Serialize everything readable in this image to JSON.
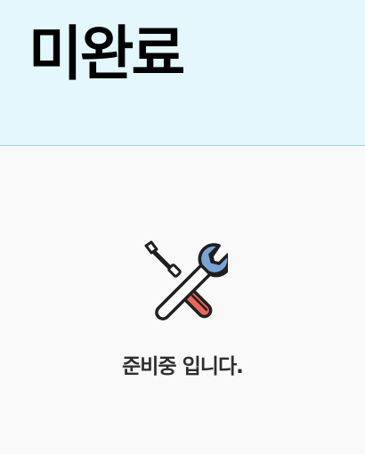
{
  "header": {
    "title": "미완료"
  },
  "main": {
    "icon": "tools-icon",
    "status_text": "준비중 입니다."
  },
  "colors": {
    "header_bg": "#e3f7fd",
    "header_border": "#9fd0dd",
    "page_bg": "#f9f9f9",
    "wrench": "#7ba3d8",
    "handle": "#e8665a",
    "outline": "#1f1f1f"
  }
}
